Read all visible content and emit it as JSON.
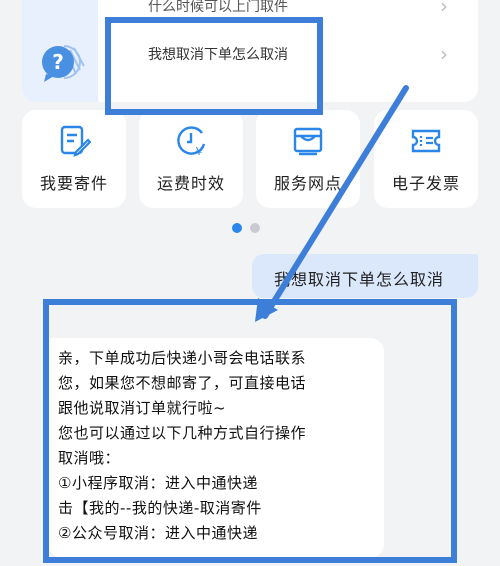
{
  "faq": {
    "items": [
      {
        "label": "什么时候可以上门取件"
      },
      {
        "label": "我想取消下单怎么取消"
      }
    ]
  },
  "features": [
    {
      "label": "我要寄件",
      "icon": "edit-document-icon"
    },
    {
      "label": "运费时效",
      "icon": "yuan-clock-icon"
    },
    {
      "label": "服务网点",
      "icon": "store-icon"
    },
    {
      "label": "电子发票",
      "icon": "invoice-ticket-icon"
    }
  ],
  "pager": {
    "current": 1,
    "total": 2
  },
  "chat": {
    "user_message": "我想取消下单怎么取消",
    "bot_lines": [
      "亲，下单成功后快递小哥会电话联系",
      "您，如果您不想邮寄了，可直接电话",
      "跟他说取消订单就行啦~",
      "您也可以通过以下几种方式自行操作",
      "取消哦：",
      "①小程序取消：进入中通快递",
      "击【我的--我的快递-取消寄件",
      "②公众号取消：进入中通快递"
    ]
  },
  "colors": {
    "accent": "#2a86e8",
    "annotation": "#3d7fd8",
    "user_bubble": "#dbe8fb",
    "faq_panel": "#e8f0fd",
    "background": "#f2f3f5"
  }
}
